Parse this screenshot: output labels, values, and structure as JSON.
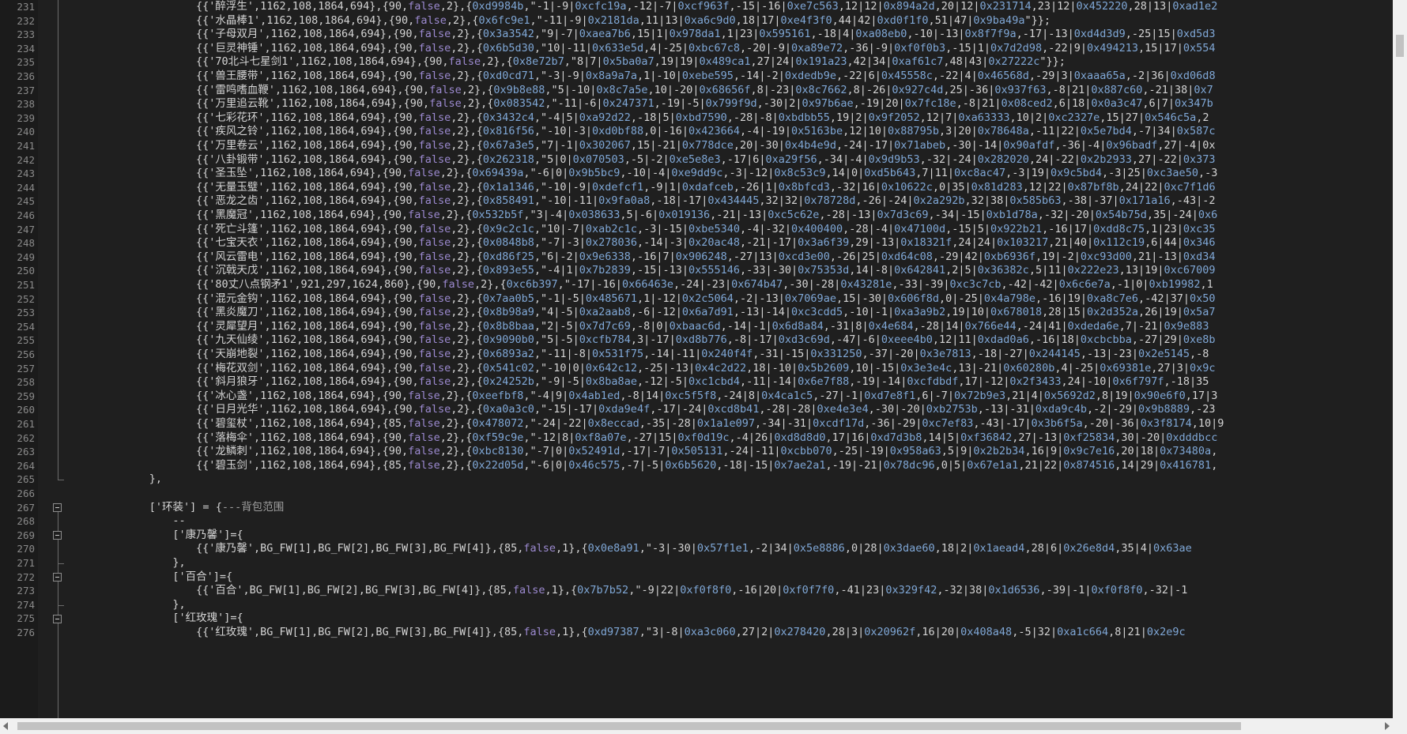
{
  "editor": {
    "theme": {
      "background": "#1f1f1f",
      "line_number": "#8a8a8a",
      "string": "#e3e3e3",
      "number": "#9c8ad0",
      "hex": "#7fa7d6",
      "comment": "#a0a0a0"
    },
    "lines": [
      {
        "no": "231",
        "text": "{{'醉浮生',1162,108,1864,694},{90,false,2},{0xd9984b,\"-1|-9|0xcfc19a,-12|-7|0xcf963f,-15|-16|0xe7c563,12|12|0x894a2d,20|12|0x231714,23|12|0x452220,28|13|0xad1e2"
      },
      {
        "no": "232",
        "text": "{{'水晶棒1',1162,108,1864,694},{90,false,2},{0x6fc9e1,\"-11|-9|0x2181da,11|13|0xa6c9d0,18|17|0xe4f3f0,44|42|0xd0f1f0,51|47|0x9ba49a\"}};"
      },
      {
        "no": "233",
        "text": "{{'子母双月',1162,108,1864,694},{90,false,2},{0x3a3542,\"9|-7|0xaea7b6,15|1|0x978da1,1|23|0x595161,-18|4|0xa08eb0,-10|-13|0x8f7f9a,-17|-13|0xd4d3d9,-25|15|0xd5d3"
      },
      {
        "no": "234",
        "text": "{{'巨灵神锤',1162,108,1864,694},{90,false,2},{0x6b5d30,\"10|-11|0x633e5d,4|-25|0xbc67c8,-20|-9|0xa89e72,-36|-9|0xf0f0b3,-15|1|0x7d2d98,-22|9|0x494213,15|17|0x554"
      },
      {
        "no": "235",
        "text": "{{'70北斗七星剑1',1162,108,1864,694},{90,false,2},{0x8e72b7,\"8|7|0x5ba0a7,19|19|0x489ca1,27|24|0x191a23,42|34|0xaf61c7,48|43|0x27222c\"}};"
      },
      {
        "no": "236",
        "text": "{{'兽王腰带',1162,108,1864,694},{90,false,2},{0xd0cd71,\"-3|-9|0x8a9a7a,1|-10|0xebe595,-14|-2|0xdedb9e,-22|6|0x45558c,-22|4|0x46568d,-29|3|0xaaa65a,-2|36|0xd06d8"
      },
      {
        "no": "237",
        "text": "{{'雷鸣嗜血鞭',1162,108,1864,694},{90,false,2},{0x9b8e88,\"5|-10|0x8c7a5e,10|-20|0x68656f,8|-23|0x8c7662,8|-26|0x927c4d,25|-36|0x937f63,-8|21|0x887c60,-21|38|0x7"
      },
      {
        "no": "238",
        "text": "{{'万里追云靴',1162,108,1864,694},{90,false,2},{0x083542,\"-11|-6|0x247371,-19|-5|0x799f9d,-30|2|0x97b6ae,-19|20|0x7fc18e,-8|21|0x08ced2,6|18|0x0a3c47,6|7|0x347b"
      },
      {
        "no": "239",
        "text": "{{'七彩花环',1162,108,1864,694},{90,false,2},{0x3432c4,\"-4|5|0xa92d22,-18|5|0xbd7590,-28|-8|0xbdbb55,19|2|0x9f2052,12|7|0xa63333,10|2|0xc2327e,15|27|0x546c5a,2"
      },
      {
        "no": "240",
        "text": "{{'疾风之铃',1162,108,1864,694},{90,false,2},{0x816f56,\"-10|-3|0xd0bf88,0|-16|0x423664,-4|-19|0x5163be,12|10|0x88795b,3|20|0x78648a,-11|22|0x5e7bd4,-7|34|0x587c"
      },
      {
        "no": "241",
        "text": "{{'万里卷云',1162,108,1864,694},{90,false,2},{0x67a3e5,\"7|-1|0x302067,15|-21|0x778dce,20|-30|0x4b4e9d,-24|-17|0x71abeb,-30|-14|0x90afdf,-36|-4|0x96badf,27|-4|0x"
      },
      {
        "no": "242",
        "text": "{{'八卦锻带',1162,108,1864,694},{90,false,2},{0x262318,\"5|0|0x070503,-5|-2|0xe5e8e3,-17|6|0xa29f56,-34|-4|0x9d9b53,-32|-24|0x282020,24|-22|0x2b2933,27|-22|0x373"
      },
      {
        "no": "243",
        "text": "{{'圣玉坠',1162,108,1864,694},{90,false,2},{0x69439a,\"-6|0|0x9b5bc9,-10|-4|0xe9dd9c,-3|-12|0x8c53c9,14|0|0xd5b643,7|11|0xc8ac47,-3|19|0x9c5bd4,-3|25|0xc3ae50,-3"
      },
      {
        "no": "244",
        "text": "{{'无量玉璧',1162,108,1864,694},{90,false,2},{0x1a1346,\"-10|-9|0xdefcf1,-9|1|0xdafceb,-26|1|0x8bfcd3,-32|16|0x10622c,0|35|0x81d283,12|22|0x87bf8b,24|22|0xc7f1d6"
      },
      {
        "no": "245",
        "text": "{{'恶龙之齿',1162,108,1864,694},{90,false,2},{0x858491,\"-10|-11|0x9fa0a8,-18|-17|0x434445,32|32|0x78728d,-26|-24|0x2a292b,32|38|0x585b63,-38|-37|0x171a16,-43|-2"
      },
      {
        "no": "246",
        "text": "{{'黑魔冠',1162,108,1864,694},{90,false,2},{0x532b5f,\"3|-4|0x038633,5|-6|0x019136,-21|-13|0xc5c62e,-28|-13|0x7d3c69,-34|-15|0xb1d78a,-32|-20|0x54b75d,35|-24|0x6"
      },
      {
        "no": "247",
        "text": "{{'死亡斗篷',1162,108,1864,694},{90,false,2},{0x9c2c1c,\"10|-7|0xab2c1c,-3|-15|0xbe5340,-4|-32|0x400400,-28|-4|0x47100d,-15|5|0x922b21,-16|17|0xdd8c75,1|23|0xc35"
      },
      {
        "no": "248",
        "text": "{{'七宝天衣',1162,108,1864,694},{90,false,2},{0x0848b8,\"-7|-3|0x278036,-14|-3|0x20ac48,-21|-17|0x3a6f39,29|-13|0x18321f,24|24|0x103217,21|40|0x112c19,6|44|0x346"
      },
      {
        "no": "249",
        "text": "{{'风云雷电',1162,108,1864,694},{90,false,2},{0xd86f25,\"6|-2|0x9e6338,-16|7|0x906248,-27|13|0xcd3e00,-26|25|0xd64c08,-29|42|0xb6936f,19|-2|0xc93d00,21|-13|0xd34"
      },
      {
        "no": "250",
        "text": "{{'沉戟天戊',1162,108,1864,694},{90,false,2},{0x893e55,\"-4|1|0x7b2839,-15|-13|0x555146,-33|-30|0x75353d,14|-8|0x642841,2|5|0x36382c,5|11|0x222e23,13|19|0xc67009"
      },
      {
        "no": "251",
        "text": "{{'80丈八点钢矛1',921,297,1624,860},{90,false,2},{0xc6b397,\"-17|-16|0x66463e,-24|-23|0x674b47,-30|-28|0x43281e,-33|-39|0xc3c7cb,-42|-42|0x6c6e7a,-1|0|0xb19982,1"
      },
      {
        "no": "252",
        "text": "{{'混元金钩',1162,108,1864,694},{90,false,2},{0x7aa0b5,\"-1|-5|0x485671,1|-12|0x2c5064,-2|-13|0x7069ae,15|-30|0x606f8d,0|-25|0x4a798e,-16|19|0xa8c7e6,-42|37|0x50"
      },
      {
        "no": "253",
        "text": "{{'黑炎魔刀',1162,108,1864,694},{90,false,2},{0x8b98a9,\"4|-5|0xa2aab8,-6|-12|0x6a7d91,-13|-14|0xc3cdd5,-10|-1|0xa3a9b2,19|10|0x678018,28|15|0x2d352a,26|19|0x5a7"
      },
      {
        "no": "254",
        "text": "{{'灵犀望月',1162,108,1864,694},{90,false,2},{0x8b8baa,\"2|-5|0x7d7c69,-8|0|0xbaac6d,-14|-1|0x6d8a84,-31|8|0x4e684,-28|14|0x766e44,-24|41|0xdeda6e,7|-21|0x9e883"
      },
      {
        "no": "255",
        "text": "{{'九天仙绫',1162,108,1864,694},{90,false,2},{0x9090b0,\"5|-5|0xcfb784,3|-17|0xd8b776,-8|-17|0xd3c69d,-47|-6|0xeee4b0,12|11|0xdad0a6,-16|18|0xcbcbba,-27|29|0xe8b"
      },
      {
        "no": "256",
        "text": "{{'天崩地裂',1162,108,1864,694},{90,false,2},{0x6893a2,\"-11|-8|0x531f75,-14|-11|0x240f4f,-31|-15|0x331250,-37|-20|0x3e7813,-18|-27|0x244145,-13|-23|0x2e5145,-8"
      },
      {
        "no": "257",
        "text": "{{'梅花双剑',1162,108,1864,694},{90,false,2},{0x541c02,\"-10|0|0x642c12,-25|-13|0x4c2d22,18|-10|0x5b2609,10|-15|0x3e3e4c,13|-21|0x60280b,4|-25|0x69381e,27|3|0x9c"
      },
      {
        "no": "258",
        "text": "{{'斜月狼牙',1162,108,1864,694},{90,false,2},{0x24252b,\"-9|-5|0x8ba8ae,-12|-5|0xc1cbd4,-11|-14|0x6e7f88,-19|-14|0xcfdbdf,17|-12|0x2f3433,24|-10|0x6f797f,-18|35"
      },
      {
        "no": "259",
        "text": "{{'冰心盏',1162,108,1864,694},{90,false,2},{0xeefbf8,\"-4|9|0x4ab1ed,-8|14|0xc5f5f8,-24|8|0x4ca1c5,-27|-1|0xd7e8f1,6|-7|0x72b9e3,21|4|0x5692d2,8|19|0x90e6f0,17|3"
      },
      {
        "no": "260",
        "text": "{{'日月光华',1162,108,1864,694},{90,false,2},{0xa0a3c0,\"-15|-17|0xda9e4f,-17|-24|0xcd8b41,-28|-28|0xe4e3e4,-30|-20|0xb2753b,-13|-31|0xda9c4b,-2|-29|0x9b8889,-23"
      },
      {
        "no": "261",
        "text": "{{'碧玺杖',1162,108,1864,694},{85,false,2},{0x478072,\"-24|-22|0x8eccad,-35|-28|0x1a1e097,-34|-31|0xcdf17d,-36|-29|0xc7ef83,-43|-17|0x3b6f5a,-20|-36|0x3f8174,10|9"
      },
      {
        "no": "262",
        "text": "{{'落梅伞',1162,108,1864,694},{90,false,2},{0xf59c9e,\"-12|8|0xf8a07e,-27|15|0xf0d19c,-4|26|0xd8d8d0,17|16|0xd7d3b8,14|5|0xf36842,27|-13|0xf25834,30|-20|0xdddbcc"
      },
      {
        "no": "263",
        "text": "{{'龙鳞刺',1162,108,1864,694},{90,false,2},{0xbc8130,\"-7|0|0x52491d,-17|-7|0x505131,-24|-11|0xcbb070,-25|-19|0x958a63,5|9|0x2b2b34,16|9|0x9c7e16,20|18|0x73480a,"
      },
      {
        "no": "264",
        "text": "{{'碧玉剑',1162,108,1864,694},{85,false,2},{0x22d05d,\"-6|0|0x46c575,-7|-5|0x6b5620,-18|-15|0x7ae2a1,-19|-21|0x78dc96,0|5|0x67e1a1,21|22|0x874516,14|29|0x416781,"
      },
      {
        "no": "265",
        "text": "},"
      },
      {
        "no": "266",
        "text": ""
      },
      {
        "no": "267",
        "text": "['环装'] = {---背包范围"
      },
      {
        "no": "268",
        "text": "--"
      },
      {
        "no": "269",
        "text": "['康乃馨']={"
      },
      {
        "no": "270",
        "text": "{{'康乃馨',BG_FW[1],BG_FW[2],BG_FW[3],BG_FW[4]},{85,false,1},{0x0e8a91,\"-3|-30|0x57f1e1,-2|34|0x5e8886,0|28|0x3dae60,18|2|0x1aead4,28|6|0x26e8d4,35|4|0x63ae"
      },
      {
        "no": "271",
        "text": "},"
      },
      {
        "no": "272",
        "text": "['百合']={"
      },
      {
        "no": "273",
        "text": "{{'百合',BG_FW[1],BG_FW[2],BG_FW[3],BG_FW[4]},{85,false,1},{0x7b7b52,\"-9|22|0xf0f8f0,-16|20|0xf0f7f0,-41|23|0x329f42,-32|38|0x1d6536,-39|-1|0xf0f8f0,-32|-1"
      },
      {
        "no": "274",
        "text": "},"
      },
      {
        "no": "275",
        "text": "['红玫瑰']={"
      },
      {
        "no": "276",
        "text": "{{'红玫瑰',BG_FW[1],BG_FW[2],BG_FW[3],BG_FW[4]},{85,false,1},{0xd97387,\"3|-8|0xa3c060,27|2|0x278420,28|3|0x20962f,16|20|0x408a48,-5|32|0xa1c664,8|21|0x2e9c"
      }
    ]
  }
}
